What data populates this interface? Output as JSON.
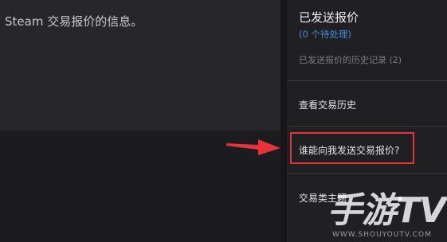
{
  "main": {
    "body_text": "Steam 交易报价的信息。"
  },
  "sidebar": {
    "title": "已发送报价",
    "pending": "(0 个待处理)",
    "history": "已发送报价的历史记录 (2)",
    "items": [
      {
        "label": "查看交易历史"
      },
      {
        "label": "谁能向我发送交易报价?"
      },
      {
        "label": "交易类主题"
      }
    ]
  },
  "annotation": {
    "highlight_color": "#e8333a"
  },
  "watermark": {
    "logo": "手游TV",
    "url": "WWW.SHOUYOUTV.COM"
  }
}
